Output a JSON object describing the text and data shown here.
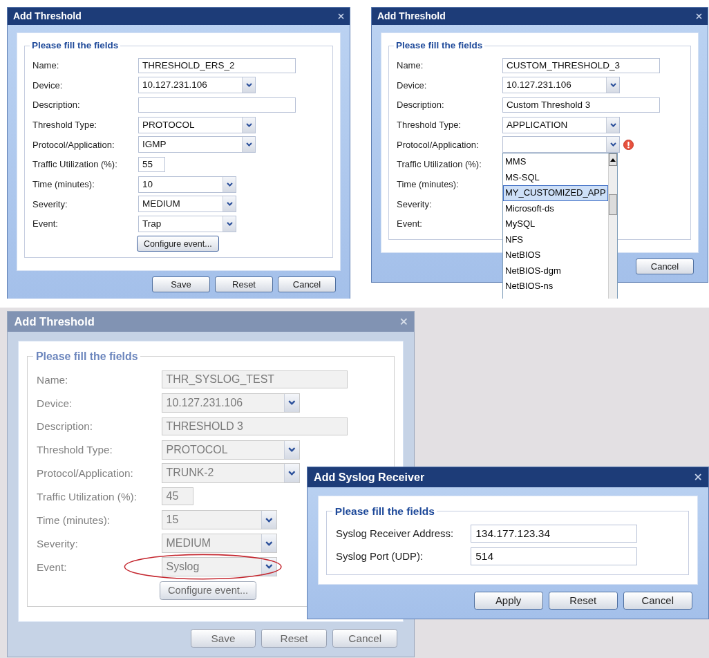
{
  "screenshots": [
    {
      "dialogs": [
        {
          "title": "Add Threshold",
          "disabled": false,
          "legend": "Please fill the fields",
          "fields": [
            {
              "label": "Name:",
              "kind": "text",
              "value": "THRESHOLD_ERS_2"
            },
            {
              "label": "Device:",
              "kind": "combo",
              "value": "10.127.231.106"
            },
            {
              "label": "Description:",
              "kind": "text"
            },
            {
              "label": "Threshold Type:",
              "kind": "combo",
              "value": "PROTOCOL"
            },
            {
              "label": "Protocol/Application:",
              "kind": "combo",
              "value": "IGMP"
            },
            {
              "label": "Traffic Utilization (%):",
              "kind": "number",
              "value": "55"
            },
            {
              "label": "Time (minutes):",
              "kind": "combo_short",
              "value": "10"
            },
            {
              "label": "Severity:",
              "kind": "combo_short",
              "value": "MEDIUM"
            },
            {
              "label": "Event:",
              "kind": "combo_short",
              "value": "Trap"
            }
          ],
          "configure": "Configure event...",
          "buttons": [
            "Save",
            "Reset",
            "Cancel"
          ]
        }
      ]
    },
    {
      "dialogs": [
        {
          "title": "Add Threshold",
          "disabled": false,
          "legend": "Please fill the fields",
          "fields": [
            {
              "label": "Name:",
              "kind": "text",
              "value": "CUSTOM_THRESHOLD_3"
            },
            {
              "label": "Device:",
              "kind": "combo",
              "value": "10.127.231.106"
            },
            {
              "label": "Description:",
              "kind": "text",
              "value": "Custom Threshold 3"
            },
            {
              "label": "Threshold Type:",
              "kind": "combo",
              "value": "APPLICATION"
            },
            {
              "label": "Protocol/Application:",
              "kind": "combo",
              "error": true,
              "dropdown": [
                {
                  "label": "MMS",
                  "selected": false
                },
                {
                  "label": "MS-SQL",
                  "selected": false
                },
                {
                  "label": "MY_CUSTOMIZED_APP",
                  "selected": true
                },
                {
                  "label": "Microsoft-ds",
                  "selected": false
                },
                {
                  "label": "MySQL",
                  "selected": false
                },
                {
                  "label": "NFS",
                  "selected": false
                },
                {
                  "label": "NetBIOS",
                  "selected": false
                },
                {
                  "label": "NetBIOS-dgm",
                  "selected": false
                },
                {
                  "label": "NetBIOS-ns",
                  "selected": false
                }
              ]
            },
            {
              "label": "Traffic Utilization (%):",
              "kind": "covered"
            },
            {
              "label": "Time (minutes):",
              "kind": "covered"
            },
            {
              "label": "Severity:",
              "kind": "covered"
            },
            {
              "label": "Event:",
              "kind": "covered"
            }
          ],
          "buttons": [
            "Cancel"
          ]
        }
      ]
    },
    {
      "dialogs": [
        {
          "title": "Add Threshold",
          "disabled": true,
          "legend": "Please fill the fields",
          "fields": [
            {
              "label": "Name:",
              "kind": "text",
              "value": "THR_SYSLOG_TEST"
            },
            {
              "label": "Device:",
              "kind": "combo",
              "value": "10.127.231.106"
            },
            {
              "label": "Description:",
              "kind": "text",
              "value": "THRESHOLD 3"
            },
            {
              "label": "Threshold Type:",
              "kind": "combo",
              "value": "PROTOCOL"
            },
            {
              "label": "Protocol/Application:",
              "kind": "combo",
              "value": "TRUNK-2"
            },
            {
              "label": "Traffic Utilization (%):",
              "kind": "number",
              "value": "45"
            },
            {
              "label": "Time (minutes):",
              "kind": "combo_short",
              "value": "15"
            },
            {
              "label": "Severity:",
              "kind": "combo_short",
              "value": "MEDIUM"
            },
            {
              "label": "Event:",
              "kind": "combo_short",
              "value": "Syslog",
              "circled": true
            }
          ],
          "configure": "Configure event...",
          "buttons": [
            "Save",
            "Reset",
            "Cancel"
          ]
        },
        {
          "title": "Add Syslog Receiver",
          "disabled": false,
          "legend": "Please fill the fields",
          "fields": [
            {
              "label": "Syslog Receiver Address:",
              "kind": "wide_text",
              "value": "134.177.123.34"
            },
            {
              "label": "Syslog Port (UDP):",
              "kind": "wide_text",
              "value": "514"
            }
          ],
          "buttons": [
            "Apply",
            "Reset",
            "Cancel"
          ]
        }
      ]
    }
  ]
}
